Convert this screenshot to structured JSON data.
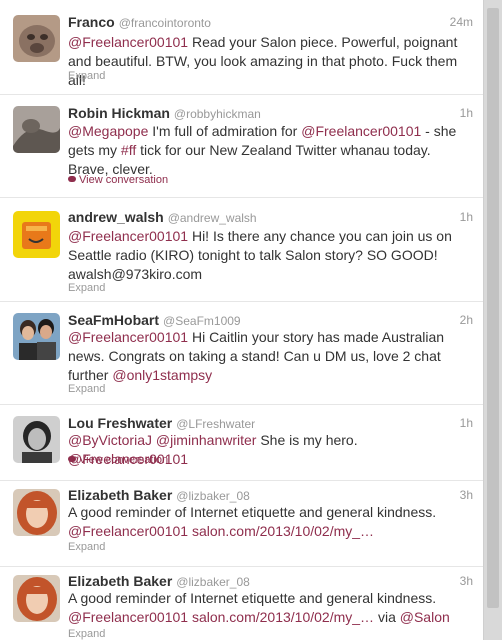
{
  "tweets": [
    {
      "name": "Franco",
      "handle": "@francointoronto",
      "time": "24m",
      "segments": [
        {
          "t": "@Freelancer00101",
          "k": "mention"
        },
        {
          "t": " Read your Salon piece. Powerful, poignant and beautiful. BTW, you look amazing in that photo. Fuck them all!",
          "k": "text"
        }
      ],
      "footer": "Expand",
      "footer_type": "expand",
      "avatar": "dog-photo"
    },
    {
      "name": "Robin Hickman",
      "handle": "@robbyhickman",
      "time": "1h",
      "segments": [
        {
          "t": "@Megapope",
          "k": "mention"
        },
        {
          "t": " I'm full of admiration for ",
          "k": "text"
        },
        {
          "t": "@Freelancer00101",
          "k": "mention"
        },
        {
          "t": " - she gets my ",
          "k": "text"
        },
        {
          "t": "#ff",
          "k": "mention"
        },
        {
          "t": " tick for our New Zealand Twitter whanau today. Brave, clever.",
          "k": "text"
        }
      ],
      "footer": "View conversation",
      "footer_type": "conversation",
      "avatar": "animal-photo"
    },
    {
      "name": "andrew_walsh",
      "handle": "@andrew_walsh",
      "time": "1h",
      "segments": [
        {
          "t": "@Freelancer00101",
          "k": "mention"
        },
        {
          "t": " Hi! Is there any chance you can join us on Seattle radio (KIRO) tonight to talk Salon story? SO GOOD! awalsh@973kiro.com",
          "k": "text"
        }
      ],
      "footer": "Expand",
      "footer_type": "expand",
      "avatar": "radio-logo"
    },
    {
      "name": "SeaFmHobart",
      "handle": "@SeaFm1009",
      "time": "2h",
      "segments": [
        {
          "t": "@Freelancer00101",
          "k": "mention"
        },
        {
          "t": " Hi Caitlin your story has made Australian news. Congrats on taking a stand! Can u DM us, love 2 chat further ",
          "k": "text"
        },
        {
          "t": "@only1stampsy",
          "k": "mention"
        }
      ],
      "footer": "Expand",
      "footer_type": "expand",
      "avatar": "couple-photo"
    },
    {
      "name": "Lou Freshwater",
      "handle": "@LFreshwater",
      "time": "1h",
      "segments": [
        {
          "t": "@ByVictoriaJ",
          "k": "mention"
        },
        {
          "t": " ",
          "k": "text"
        },
        {
          "t": "@jiminhanwriter",
          "k": "mention"
        },
        {
          "t": " She is my hero. ",
          "k": "text"
        },
        {
          "t": "@Freelancer00101",
          "k": "mention"
        }
      ],
      "footer": "View conversation",
      "footer_type": "conversation",
      "avatar": "portrait-photo"
    },
    {
      "name": "Elizabeth Baker",
      "handle": "@lizbaker_08",
      "time": "3h",
      "segments": [
        {
          "t": "A good reminder of Internet etiquette and general kindness. ",
          "k": "text"
        },
        {
          "t": "@Freelancer00101",
          "k": "mention"
        },
        {
          "t": " ",
          "k": "text"
        },
        {
          "t": "salon.com/2013/10/02/my_…",
          "k": "link"
        }
      ],
      "footer": "Expand",
      "footer_type": "expand",
      "avatar": "redhead-photo"
    },
    {
      "name": "Elizabeth Baker",
      "handle": "@lizbaker_08",
      "time": "3h",
      "segments": [
        {
          "t": "A good reminder of Internet etiquette and general kindness. ",
          "k": "text"
        },
        {
          "t": "@Freelancer00101",
          "k": "mention"
        },
        {
          "t": " ",
          "k": "text"
        },
        {
          "t": "salon.com/2013/10/02/my_…",
          "k": "link"
        },
        {
          "t": " via ",
          "k": "text"
        },
        {
          "t": "@Salon",
          "k": "mention"
        }
      ],
      "footer": "Expand",
      "footer_type": "expand",
      "avatar": "redhead-photo"
    }
  ]
}
